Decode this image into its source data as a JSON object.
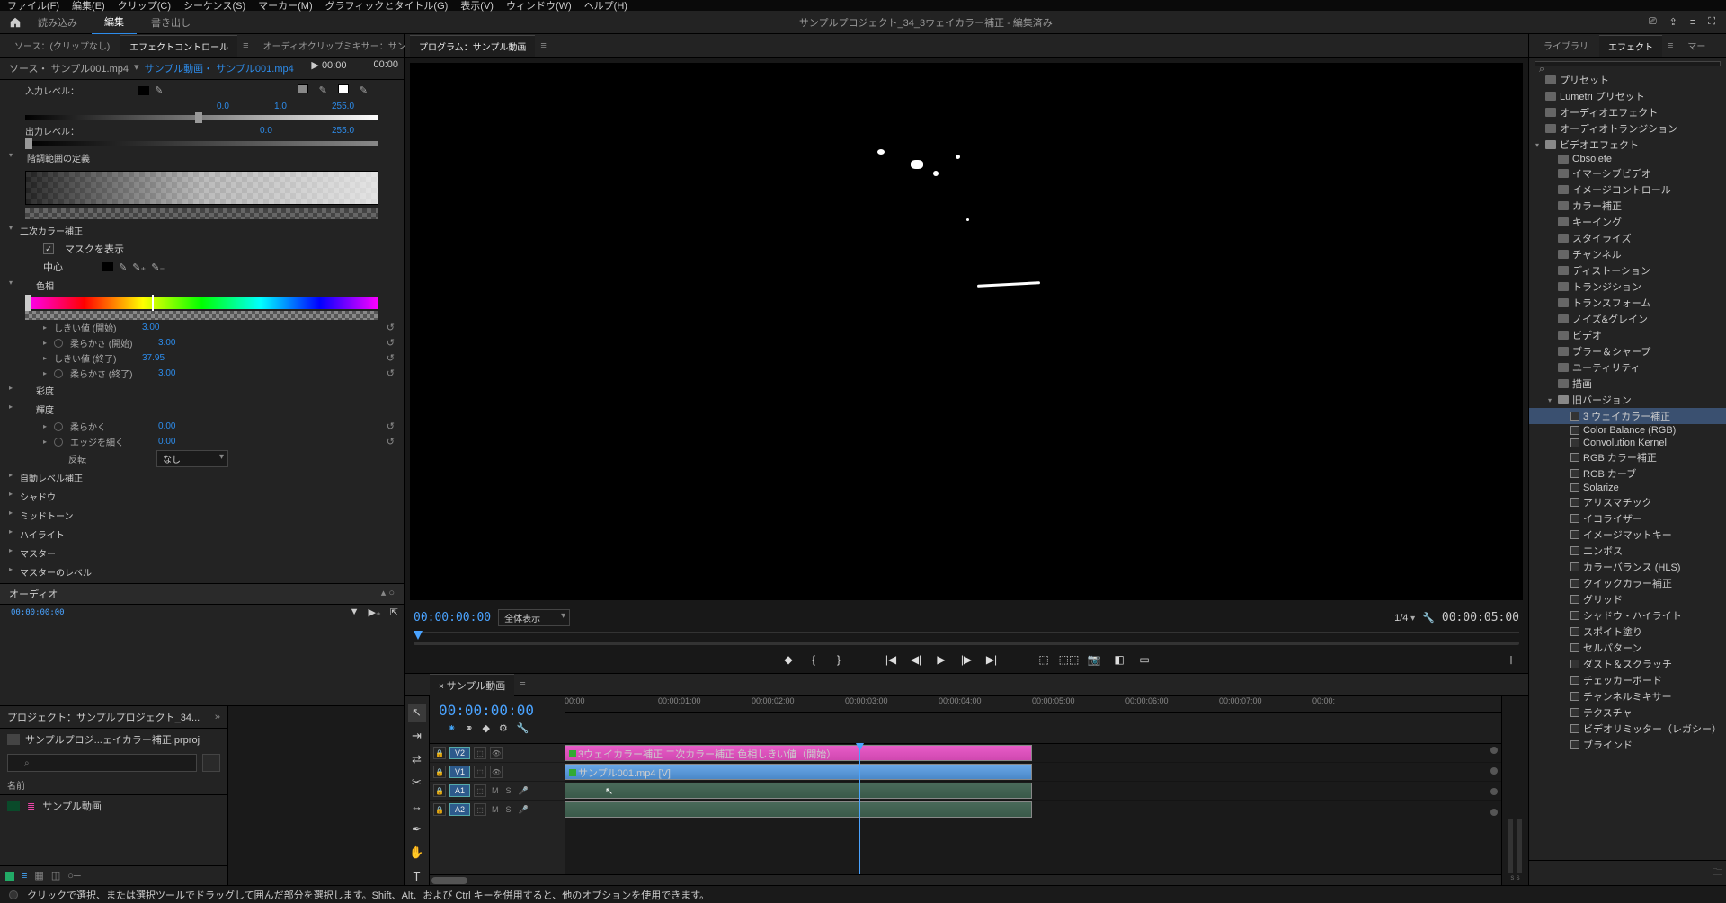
{
  "menubar": [
    "ファイル(F)",
    "編集(E)",
    "クリップ(C)",
    "シーケンス(S)",
    "マーカー(M)",
    "グラフィックとタイトル(G)",
    "表示(V)",
    "ウィンドウ(W)",
    "ヘルプ(H)"
  ],
  "workspace": {
    "tabs": [
      "読み込み",
      "編集",
      "書き出し"
    ],
    "active": 1,
    "title": "サンプルプロジェクト_34_3ウェイカラー補正 - 編集済み"
  },
  "leftTabs": {
    "source": "ソース：(クリップなし)",
    "ec": "エフェクトコントロール",
    "audio": "オーディオクリップミキサー：サンプル動画"
  },
  "programTab": "プログラム：サンプル動画",
  "rightTabs": {
    "lib": "ライブラリ",
    "fx": "エフェクト",
    "marker": "マー"
  },
  "ec": {
    "src": "ソース・ サンプル001.mp4",
    "seq": "サンプル動画・ サンプル001.mp4",
    "tl": [
      "▶ 00:00",
      "00:00"
    ],
    "inputLevel": "入力レベル：",
    "outputLevel": "出力レベル：",
    "inVals": [
      "0.0",
      "1.0",
      "255.0"
    ],
    "outVals": [
      "0.0",
      "255.0"
    ],
    "tonal": "階調範囲の定義",
    "secondary": "二次カラー補正",
    "showMask": "マスクを表示",
    "center": "中心",
    "hue": "色相",
    "params": [
      {
        "label": "しきい値 (開始)",
        "val": "3.00"
      },
      {
        "label": "柔らかさ (開始)",
        "val": "3.00",
        "kf": true
      },
      {
        "label": "しきい値 (終了)",
        "val": "37.95"
      },
      {
        "label": "柔らかさ (終了)",
        "val": "3.00",
        "kf": true
      }
    ],
    "sat": "彩度",
    "luma": "輝度",
    "soften": {
      "label": "柔らかく",
      "val": "0.00"
    },
    "edgeThin": {
      "label": "エッジを細く",
      "val": "0.00"
    },
    "invert": {
      "label": "反転",
      "val": "なし"
    },
    "sections": [
      "自動レベル補正",
      "シャドウ",
      "ミッドトーン",
      "ハイライト",
      "マスター",
      "マスターのレベル"
    ],
    "audioHdr": "オーディオ",
    "tcSmall": "00:00:00:00"
  },
  "program": {
    "tc": "00:00:00:00",
    "zoom": "全体表示",
    "scale": "1/4",
    "dur": "00:00:05:00"
  },
  "project": {
    "title": "プロジェクト：サンプルプロジェクト_34...",
    "file": "サンプルプロジ...ェイカラー補正.prproj",
    "colName": "名前",
    "item": "サンプル動画"
  },
  "timeline": {
    "tab": "サンプル動画",
    "tc": "00:00:00:00",
    "ticks": [
      "00:00",
      "00:00:01:00",
      "00:00:02:00",
      "00:00:03:00",
      "00:00:04:00",
      "00:00:05:00",
      "00:00:06:00",
      "00:00:07:00",
      "00:00:"
    ],
    "tracks": {
      "v2": "V2",
      "v1": "V1",
      "a1": "A1",
      "a2": "A2"
    },
    "clips": {
      "fx": "3ウェイカラー補正 二次カラー補正 色相しきい値（開始）",
      "vid": "サンプル001.mp4 [V]"
    },
    "m": "M",
    "s": "S"
  },
  "effects": {
    "root": [
      {
        "label": "プリセット",
        "icon": "star"
      },
      {
        "label": "Lumetri プリセット"
      },
      {
        "label": "オーディオエフェクト"
      },
      {
        "label": "オーディオトランジション"
      },
      {
        "label": "ビデオエフェクト",
        "open": true,
        "children": [
          {
            "label": "Obsolete"
          },
          {
            "label": "イマーシブビデオ"
          },
          {
            "label": "イメージコントロール"
          },
          {
            "label": "カラー補正"
          },
          {
            "label": "キーイング"
          },
          {
            "label": "スタイライズ"
          },
          {
            "label": "チャンネル"
          },
          {
            "label": "ディストーション"
          },
          {
            "label": "トランジション"
          },
          {
            "label": "トランスフォーム"
          },
          {
            "label": "ノイズ&グレイン"
          },
          {
            "label": "ビデオ"
          },
          {
            "label": "ブラー＆シャープ"
          },
          {
            "label": "ユーティリティ"
          },
          {
            "label": "描画"
          },
          {
            "label": "旧バージョン",
            "open": true,
            "children": [
              {
                "label": "3 ウェイカラー補正",
                "preset": true,
                "selected": true
              },
              {
                "label": "Color Balance (RGB)",
                "preset": true
              },
              {
                "label": "Convolution Kernel",
                "preset": true
              },
              {
                "label": "RGB カラー補正",
                "preset": true
              },
              {
                "label": "RGB カーブ",
                "preset": true
              },
              {
                "label": "Solarize",
                "preset": true
              },
              {
                "label": "アリスマチック",
                "preset": true
              },
              {
                "label": "イコライザー",
                "preset": true
              },
              {
                "label": "イメージマットキー",
                "preset": true
              },
              {
                "label": "エンボス",
                "preset": true
              },
              {
                "label": "カラーバランス (HLS)",
                "preset": true
              },
              {
                "label": "クイックカラー補正",
                "preset": true
              },
              {
                "label": "グリッド",
                "preset": true
              },
              {
                "label": "シャドウ・ハイライト",
                "preset": true
              },
              {
                "label": "スポイト塗り",
                "preset": true
              },
              {
                "label": "セルパターン",
                "preset": true
              },
              {
                "label": "ダスト＆スクラッチ",
                "preset": true
              },
              {
                "label": "チェッカーボード",
                "preset": true
              },
              {
                "label": "チャンネルミキサー",
                "preset": true
              },
              {
                "label": "テクスチャ",
                "preset": true
              },
              {
                "label": "ビデオリミッター（レガシー）",
                "preset": true
              },
              {
                "label": "ブラインド",
                "preset": true
              }
            ]
          }
        ]
      }
    ]
  },
  "status": "クリックで選択、または選択ツールでドラッグして囲んだ部分を選択します。Shift、Alt、および Ctrl キーを併用すると、他のオプションを使用できます。"
}
